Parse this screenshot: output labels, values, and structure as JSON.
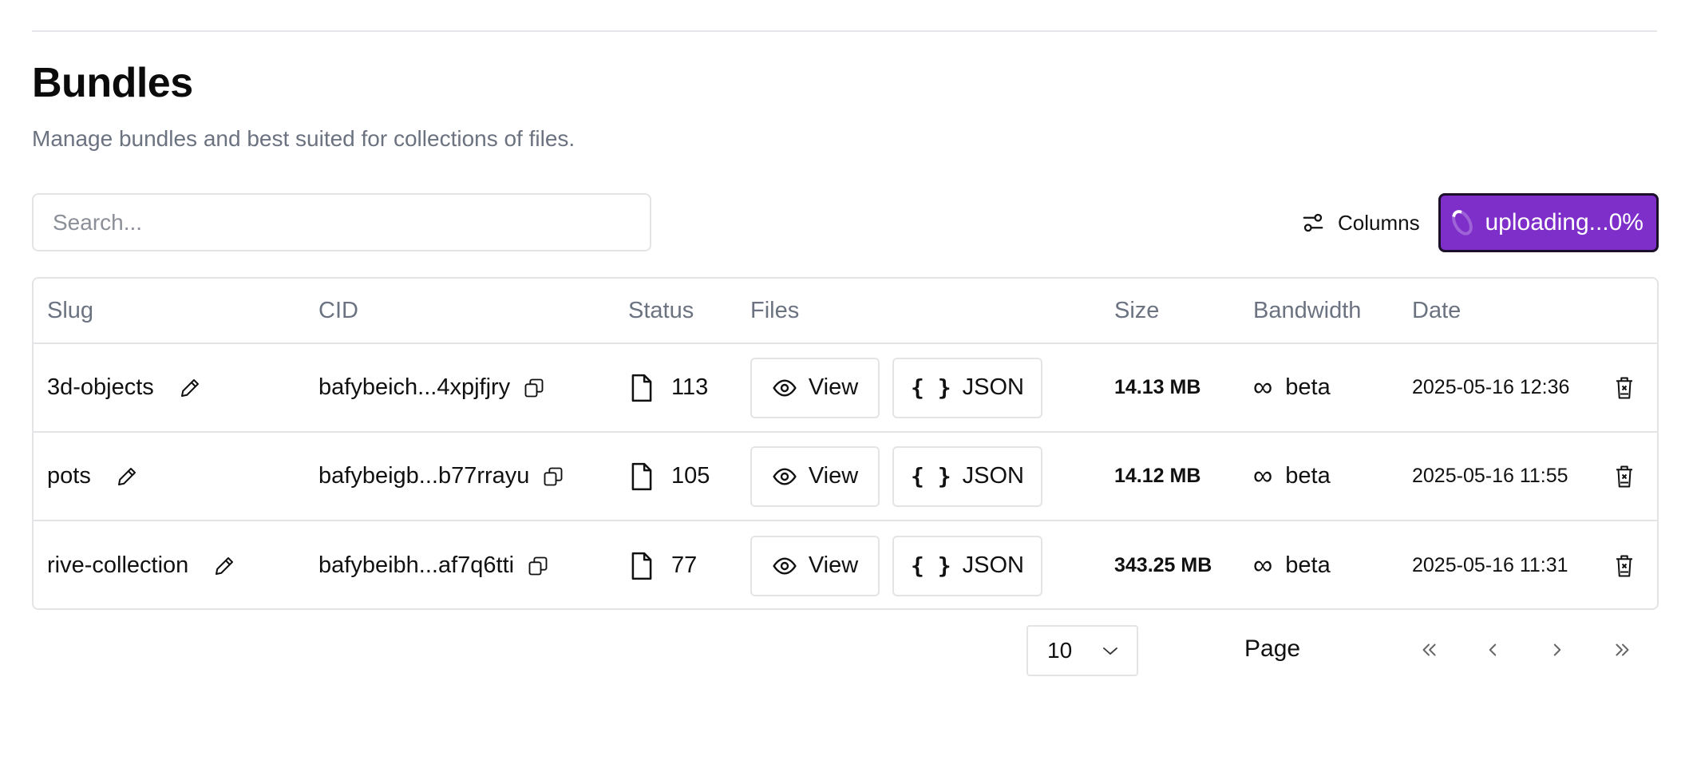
{
  "page": {
    "title": "Bundles",
    "subtitle": "Manage bundles and best suited for collections of files."
  },
  "toolbar": {
    "search_placeholder": "Search...",
    "columns_label": "Columns",
    "upload_label": "uploading...0%",
    "upload_progress_percent": 0,
    "accent_color": "#7e2fc9"
  },
  "table": {
    "headers": [
      "Slug",
      "CID",
      "Status",
      "Files",
      "Size",
      "Bandwidth",
      "Date"
    ],
    "view_label": "View",
    "json_label": "JSON",
    "json_braces": "{ }",
    "rows": [
      {
        "slug": "3d-objects",
        "cid": "bafybeich...4xpjfjry",
        "files": "113",
        "size": "14.13 MB",
        "bandwidth_symbol": "∞",
        "bandwidth": "beta",
        "date": "2025-05-16 12:36"
      },
      {
        "slug": "pots",
        "cid": "bafybeigb...b77rrayu",
        "files": "105",
        "size": "14.12 MB",
        "bandwidth_symbol": "∞",
        "bandwidth": "beta",
        "date": "2025-05-16 11:55"
      },
      {
        "slug": "rive-collection",
        "cid": "bafybeibh...af7q6tti",
        "files": "77",
        "size": "343.25 MB",
        "bandwidth_symbol": "∞",
        "bandwidth": "beta",
        "date": "2025-05-16 11:31"
      }
    ]
  },
  "pagination": {
    "page_size": "10",
    "page_label": "Page",
    "icons": [
      "first-page-icon",
      "previous-page-icon",
      "next-page-icon",
      "last-page-icon"
    ]
  }
}
